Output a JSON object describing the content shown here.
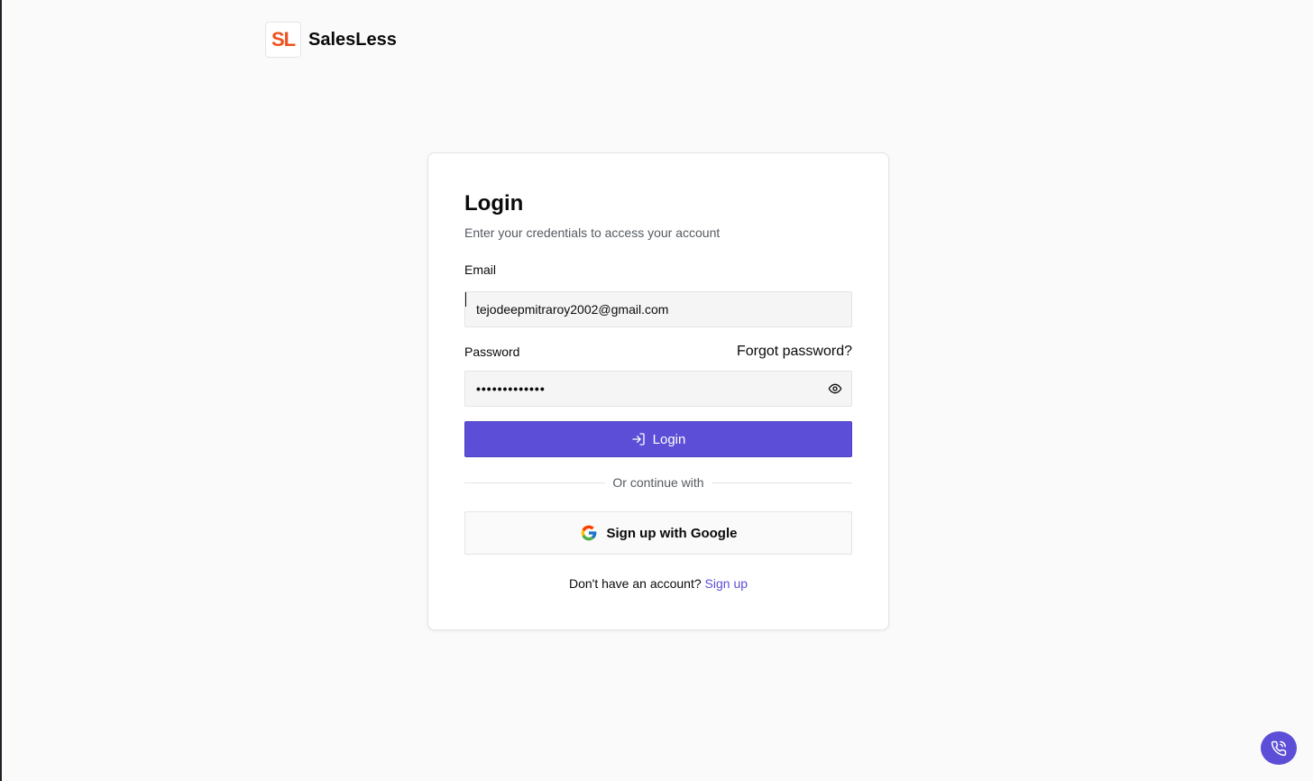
{
  "brand": {
    "logo_text": "SL",
    "name": "SalesLess"
  },
  "login_card": {
    "title": "Login",
    "subtitle": "Enter your credentials to access your account",
    "email": {
      "label": "Email",
      "value": "tejodeepmitraroy2002@gmail.com"
    },
    "password": {
      "label": "Password",
      "masked_value": "•••••••••••••",
      "forgot_link": "Forgot password?"
    },
    "login_button": "Login",
    "divider_text": "Or continue with",
    "google_button": "Sign up with Google",
    "signup_prompt": "Don't have an account?",
    "signup_link": "Sign up"
  },
  "colors": {
    "accent": "#5c4ed6",
    "logo": "#f0501e",
    "background": "#fafafa"
  },
  "icons": {
    "eye": "eye-icon",
    "login": "login-arrow-icon",
    "google": "google-icon",
    "call": "phone-call-icon"
  }
}
